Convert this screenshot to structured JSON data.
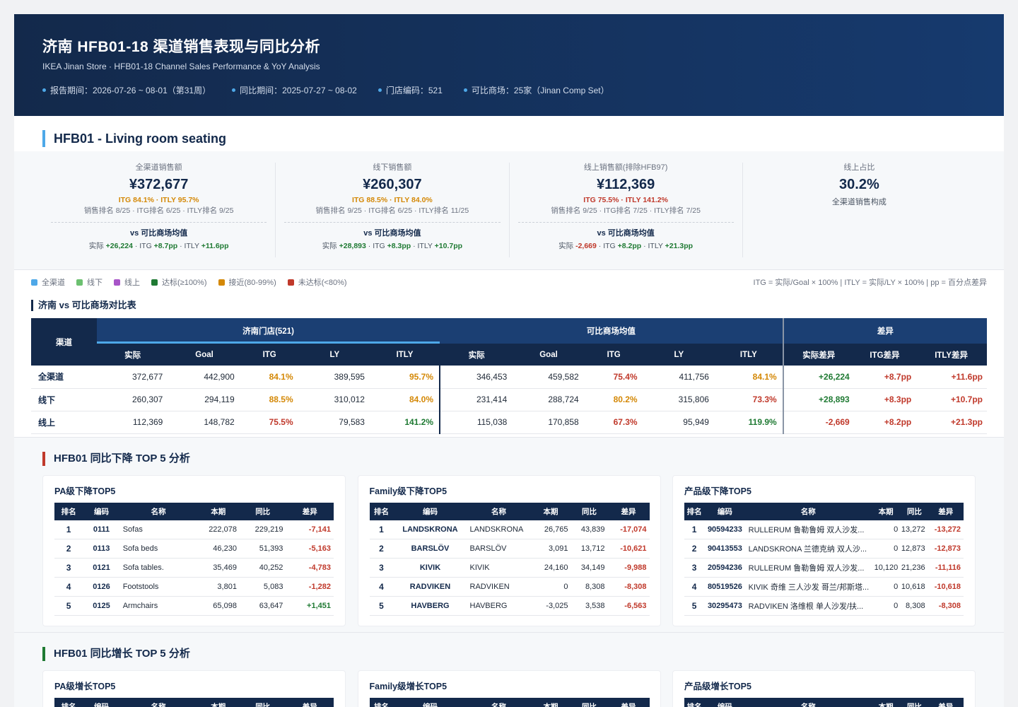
{
  "header": {
    "title": "济南 HFB01-18 渠道销售表现与同比分析",
    "subtitle": "IKEA Jinan Store · HFB01-18 Channel Sales Performance & YoY Analysis",
    "meta": [
      "报告期间：2026-07-26 ~ 08-01（第31周）",
      "同比期间：2025-07-27 ~ 08-02",
      "门店编码：521",
      "可比商场：25家（Jinan Comp Set）"
    ]
  },
  "hfb_title": "HFB01 - Living room seating",
  "kpis": [
    {
      "label": "全渠道销售额",
      "value": "¥372,677",
      "itg": "ITG 84.1% · ITLY 95.7%",
      "itg_color": "#d48806",
      "rank": "销售排名 8/25 · ITG排名 6/25 · ITLY排名 9/25",
      "vs_title": "vs 可比商场均值",
      "vs_prefix1": "实际 ",
      "vs_v1": "+26,224",
      "vs_c1": "#1f7a33",
      "vs_prefix2": " · ITG ",
      "vs_v2": "+8.7pp",
      "vs_c2": "#1f7a33",
      "vs_prefix3": " · ITLY ",
      "vs_v3": "+11.6pp",
      "vs_c3": "#1f7a33"
    },
    {
      "label": "线下销售额",
      "value": "¥260,307",
      "itg": "ITG 88.5% · ITLY 84.0%",
      "itg_color": "#d48806",
      "rank": "销售排名 9/25 · ITG排名 6/25 · ITLY排名 11/25",
      "vs_title": "vs 可比商场均值",
      "vs_prefix1": "实际 ",
      "vs_v1": "+28,893",
      "vs_c1": "#1f7a33",
      "vs_prefix2": " · ITG ",
      "vs_v2": "+8.3pp",
      "vs_c2": "#1f7a33",
      "vs_prefix3": " · ITLY ",
      "vs_v3": "+10.7pp",
      "vs_c3": "#1f7a33"
    },
    {
      "label": "线上销售额(排除HFB97)",
      "value": "¥112,369",
      "itg": "ITG 75.5% · ITLY 141.2%",
      "itg_color": "#c0392b",
      "rank": "销售排名 9/25 · ITG排名 7/25 · ITLY排名 7/25",
      "vs_title": "vs 可比商场均值",
      "vs_prefix1": "实际 ",
      "vs_v1": "-2,669",
      "vs_c1": "#c0392b",
      "vs_prefix2": " · ITG ",
      "vs_v2": "+8.2pp",
      "vs_c2": "#1f7a33",
      "vs_prefix3": " · ITLY ",
      "vs_v3": "+21.3pp",
      "vs_c3": "#1f7a33"
    }
  ],
  "online_share": {
    "label": "线上占比",
    "value": "30.2%",
    "note": "全渠道销售构成"
  },
  "legend": [
    {
      "label": "全渠道",
      "color": "#4ea8e8"
    },
    {
      "label": "线下",
      "color": "#6cc070"
    },
    {
      "label": "线上",
      "color": "#a855c8"
    },
    {
      "label": "达标(≥100%)",
      "color": "#1f7a33"
    },
    {
      "label": "接近(80-99%)",
      "color": "#d48806"
    },
    {
      "label": "未达标(<80%)",
      "color": "#c0392b"
    }
  ],
  "formula_note": "ITG = 实际/Goal × 100% | ITLY = 实际/LY × 100% | pp = 百分点差异",
  "compare": {
    "title": "济南 vs 可比商场对比表",
    "channel_header": "渠道",
    "group_store": "济南门店(521)",
    "group_comp": "可比商场均值",
    "group_diff": "差异",
    "sub_headers": [
      "实际",
      "Goal",
      "ITG",
      "LY",
      "ITLY",
      "实际",
      "Goal",
      "ITG",
      "LY",
      "ITLY",
      "实际差异",
      "ITG差异",
      "ITLY差异"
    ],
    "rows": [
      {
        "channel": "全渠道",
        "cells": [
          {
            "v": "372,677",
            "c": ""
          },
          {
            "v": "442,900",
            "c": ""
          },
          {
            "v": "84.1%",
            "c": "orange"
          },
          {
            "v": "389,595",
            "c": ""
          },
          {
            "v": "95.7%",
            "c": "orange"
          },
          {
            "v": "346,453",
            "c": ""
          },
          {
            "v": "459,582",
            "c": ""
          },
          {
            "v": "75.4%",
            "c": "red"
          },
          {
            "v": "411,756",
            "c": ""
          },
          {
            "v": "84.1%",
            "c": "orange"
          },
          {
            "v": "+26,224",
            "c": "green"
          },
          {
            "v": "+8.7pp",
            "c": "red"
          },
          {
            "v": "+11.6pp",
            "c": "red"
          }
        ]
      },
      {
        "channel": "线下",
        "cells": [
          {
            "v": "260,307",
            "c": ""
          },
          {
            "v": "294,119",
            "c": ""
          },
          {
            "v": "88.5%",
            "c": "orange"
          },
          {
            "v": "310,012",
            "c": ""
          },
          {
            "v": "84.0%",
            "c": "orange"
          },
          {
            "v": "231,414",
            "c": ""
          },
          {
            "v": "288,724",
            "c": ""
          },
          {
            "v": "80.2%",
            "c": "orange"
          },
          {
            "v": "315,806",
            "c": ""
          },
          {
            "v": "73.3%",
            "c": "red"
          },
          {
            "v": "+28,893",
            "c": "green"
          },
          {
            "v": "+8.3pp",
            "c": "red"
          },
          {
            "v": "+10.7pp",
            "c": "red"
          }
        ]
      },
      {
        "channel": "线上",
        "cells": [
          {
            "v": "112,369",
            "c": ""
          },
          {
            "v": "148,782",
            "c": ""
          },
          {
            "v": "75.5%",
            "c": "red"
          },
          {
            "v": "79,583",
            "c": ""
          },
          {
            "v": "141.2%",
            "c": "green"
          },
          {
            "v": "115,038",
            "c": ""
          },
          {
            "v": "170,858",
            "c": ""
          },
          {
            "v": "67.3%",
            "c": "red"
          },
          {
            "v": "95,949",
            "c": ""
          },
          {
            "v": "119.9%",
            "c": "green"
          },
          {
            "v": "-2,669",
            "c": "red"
          },
          {
            "v": "+8.2pp",
            "c": "red"
          },
          {
            "v": "+21.3pp",
            "c": "red"
          }
        ]
      }
    ]
  },
  "decline": {
    "title": "HFB01 同比下降 TOP 5 分析",
    "cards": [
      {
        "title": "PA级下降TOP5",
        "headers": [
          "排名",
          "编码",
          "名称",
          "本期",
          "同比",
          "差异"
        ],
        "rows": [
          [
            "1",
            "0111",
            "Sofas",
            "222,078",
            "229,219",
            "-7,141"
          ],
          [
            "2",
            "0113",
            "Sofa beds",
            "46,230",
            "51,393",
            "-5,163"
          ],
          [
            "3",
            "0121",
            "Sofa tables.",
            "35,469",
            "40,252",
            "-4,783"
          ],
          [
            "4",
            "0126",
            "Footstools",
            "3,801",
            "5,083",
            "-1,282"
          ],
          [
            "5",
            "0125",
            "Armchairs",
            "65,098",
            "63,647",
            "+1,451"
          ]
        ]
      },
      {
        "title": "Family级下降TOP5",
        "headers": [
          "排名",
          "编码",
          "名称",
          "本期",
          "同比",
          "差异"
        ],
        "rows": [
          [
            "1",
            "LANDSKRONA",
            "LANDSKRONA",
            "26,765",
            "43,839",
            "-17,074"
          ],
          [
            "2",
            "BARSLÖV",
            "BARSLÖV",
            "3,091",
            "13,712",
            "-10,621"
          ],
          [
            "3",
            "KIVIK",
            "KIVIK",
            "24,160",
            "34,149",
            "-9,988"
          ],
          [
            "4",
            "RADVIKEN",
            "RADVIKEN",
            "0",
            "8,308",
            "-8,308"
          ],
          [
            "5",
            "HAVBERG",
            "HAVBERG",
            "-3,025",
            "3,538",
            "-6,563"
          ]
        ]
      },
      {
        "title": "产品级下降TOP5",
        "headers": [
          "排名",
          "编码",
          "名称",
          "本期",
          "同比",
          "差异"
        ],
        "rows": [
          [
            "1",
            "90594233",
            "RULLERUM 鲁勒鲁姆 双人沙发...",
            "0",
            "13,272",
            "-13,272"
          ],
          [
            "2",
            "90413553",
            "LANDSKRONA 兰德克纳 双人沙...",
            "0",
            "12,873",
            "-12,873"
          ],
          [
            "3",
            "20594236",
            "RULLERUM 鲁勒鲁姆 双人沙发...",
            "10,120",
            "21,236",
            "-11,116"
          ],
          [
            "4",
            "80519526",
            "KIVIK 奇维 三人沙发 哥兰/邦斯塔...",
            "0",
            "10,618",
            "-10,618"
          ],
          [
            "5",
            "30295473",
            "RADVIKEN 洛维根 单人沙发/扶...",
            "0",
            "8,308",
            "-8,308"
          ]
        ]
      }
    ]
  },
  "growth": {
    "title": "HFB01 同比增长 TOP 5 分析",
    "cards": [
      {
        "title": "PA级增长TOP5",
        "headers": [
          "排名",
          "编码",
          "名称",
          "本期",
          "同比",
          "差异"
        ]
      },
      {
        "title": "Family级增长TOP5",
        "headers": [
          "排名",
          "编码",
          "名称",
          "本期",
          "同比",
          "差异"
        ]
      },
      {
        "title": "产品级增长TOP5",
        "headers": [
          "排名",
          "编码",
          "名称",
          "本期",
          "同比",
          "差异"
        ]
      }
    ]
  }
}
